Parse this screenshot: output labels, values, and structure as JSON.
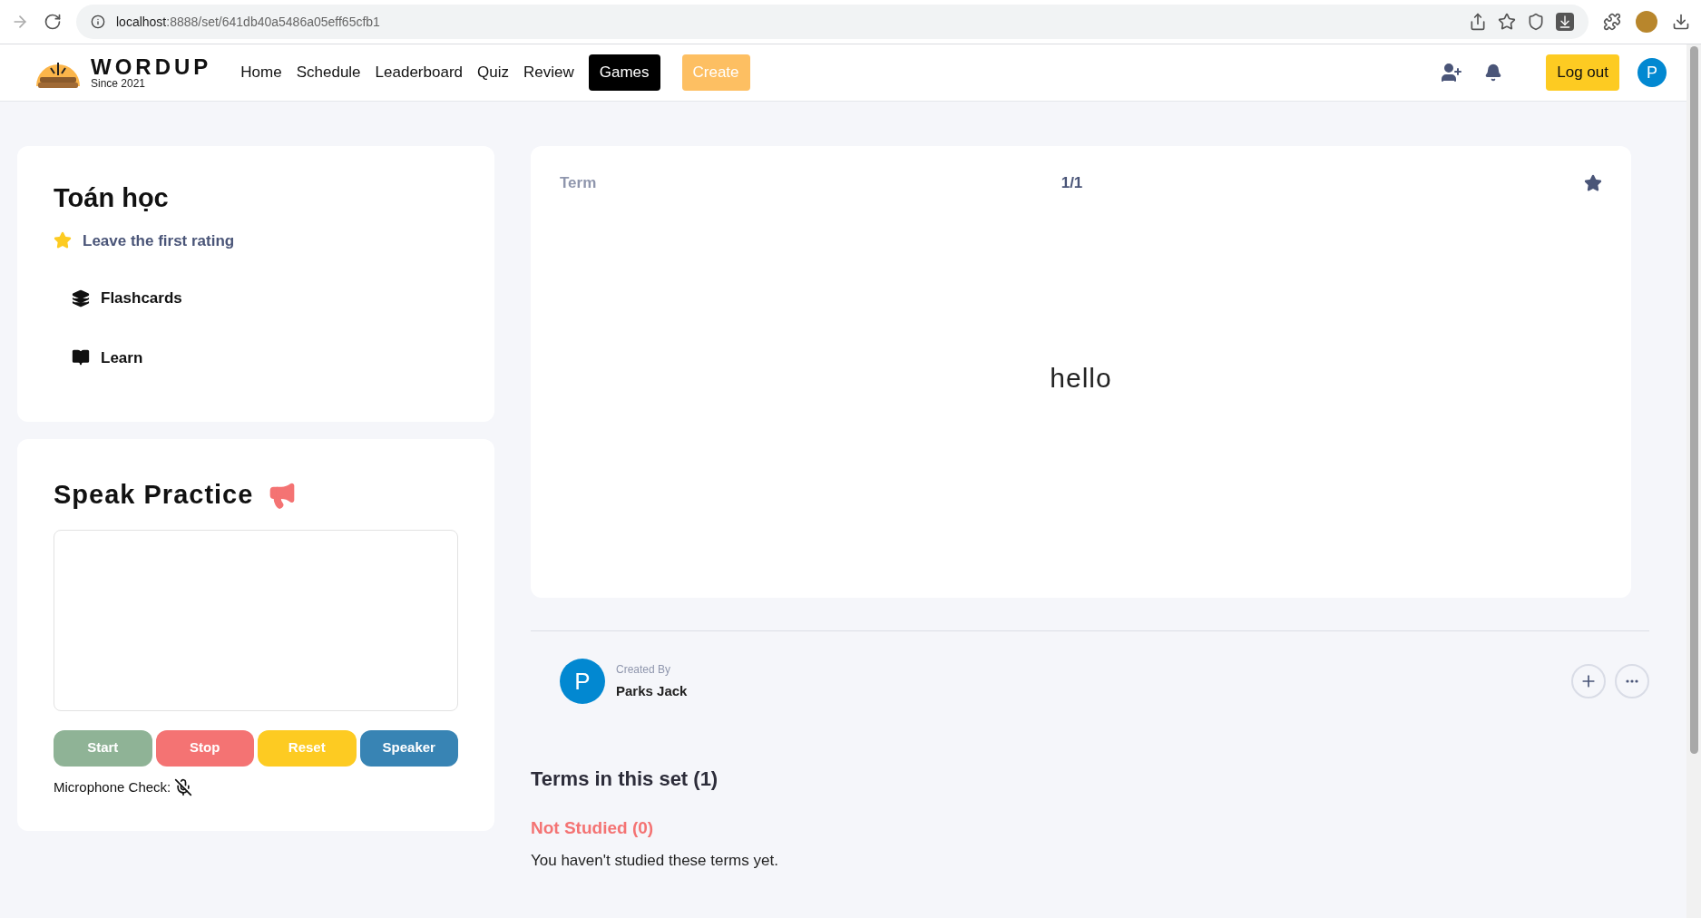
{
  "browser": {
    "url_host": "localhost",
    "url_rest": ":8888/set/641db40a5486a05eff65cfb1"
  },
  "navbar": {
    "logo_title": "WORDUP",
    "logo_subtitle": "Since 2021",
    "links": [
      {
        "label": "Home",
        "selected": false
      },
      {
        "label": "Schedule",
        "selected": false
      },
      {
        "label": "Leaderboard",
        "selected": false
      },
      {
        "label": "Quiz",
        "selected": false
      },
      {
        "label": "Review",
        "selected": false
      },
      {
        "label": "Games",
        "selected": true
      }
    ],
    "create_button": "Create",
    "logout_button": "Log out",
    "avatar_letter": "P"
  },
  "set_card": {
    "title": "Toán học",
    "rating_text": "Leave the first rating",
    "modes": [
      {
        "kind": "flashcards",
        "label": "Flashcards"
      },
      {
        "kind": "learn",
        "label": "Learn"
      }
    ]
  },
  "speak_practice": {
    "title": "Speak Practice",
    "buttons": [
      {
        "label": "Start",
        "color": "#8fb396"
      },
      {
        "label": "Stop",
        "color": "#f47373"
      },
      {
        "label": "Reset",
        "color": "#fdcb22"
      },
      {
        "label": "Speaker",
        "color": "#3884b4"
      }
    ],
    "mic_label": "Microphone Check:"
  },
  "flashcard": {
    "side_label": "Term",
    "counter": "1/1",
    "content": "hello"
  },
  "creator": {
    "label": "Created By",
    "name": "Parks Jack",
    "avatar_letter": "P"
  },
  "terms": {
    "heading": "Terms in this set (1)",
    "not_studied_heading": "Not Studied (0)",
    "not_studied_message": "You haven't studied these terms yet."
  }
}
